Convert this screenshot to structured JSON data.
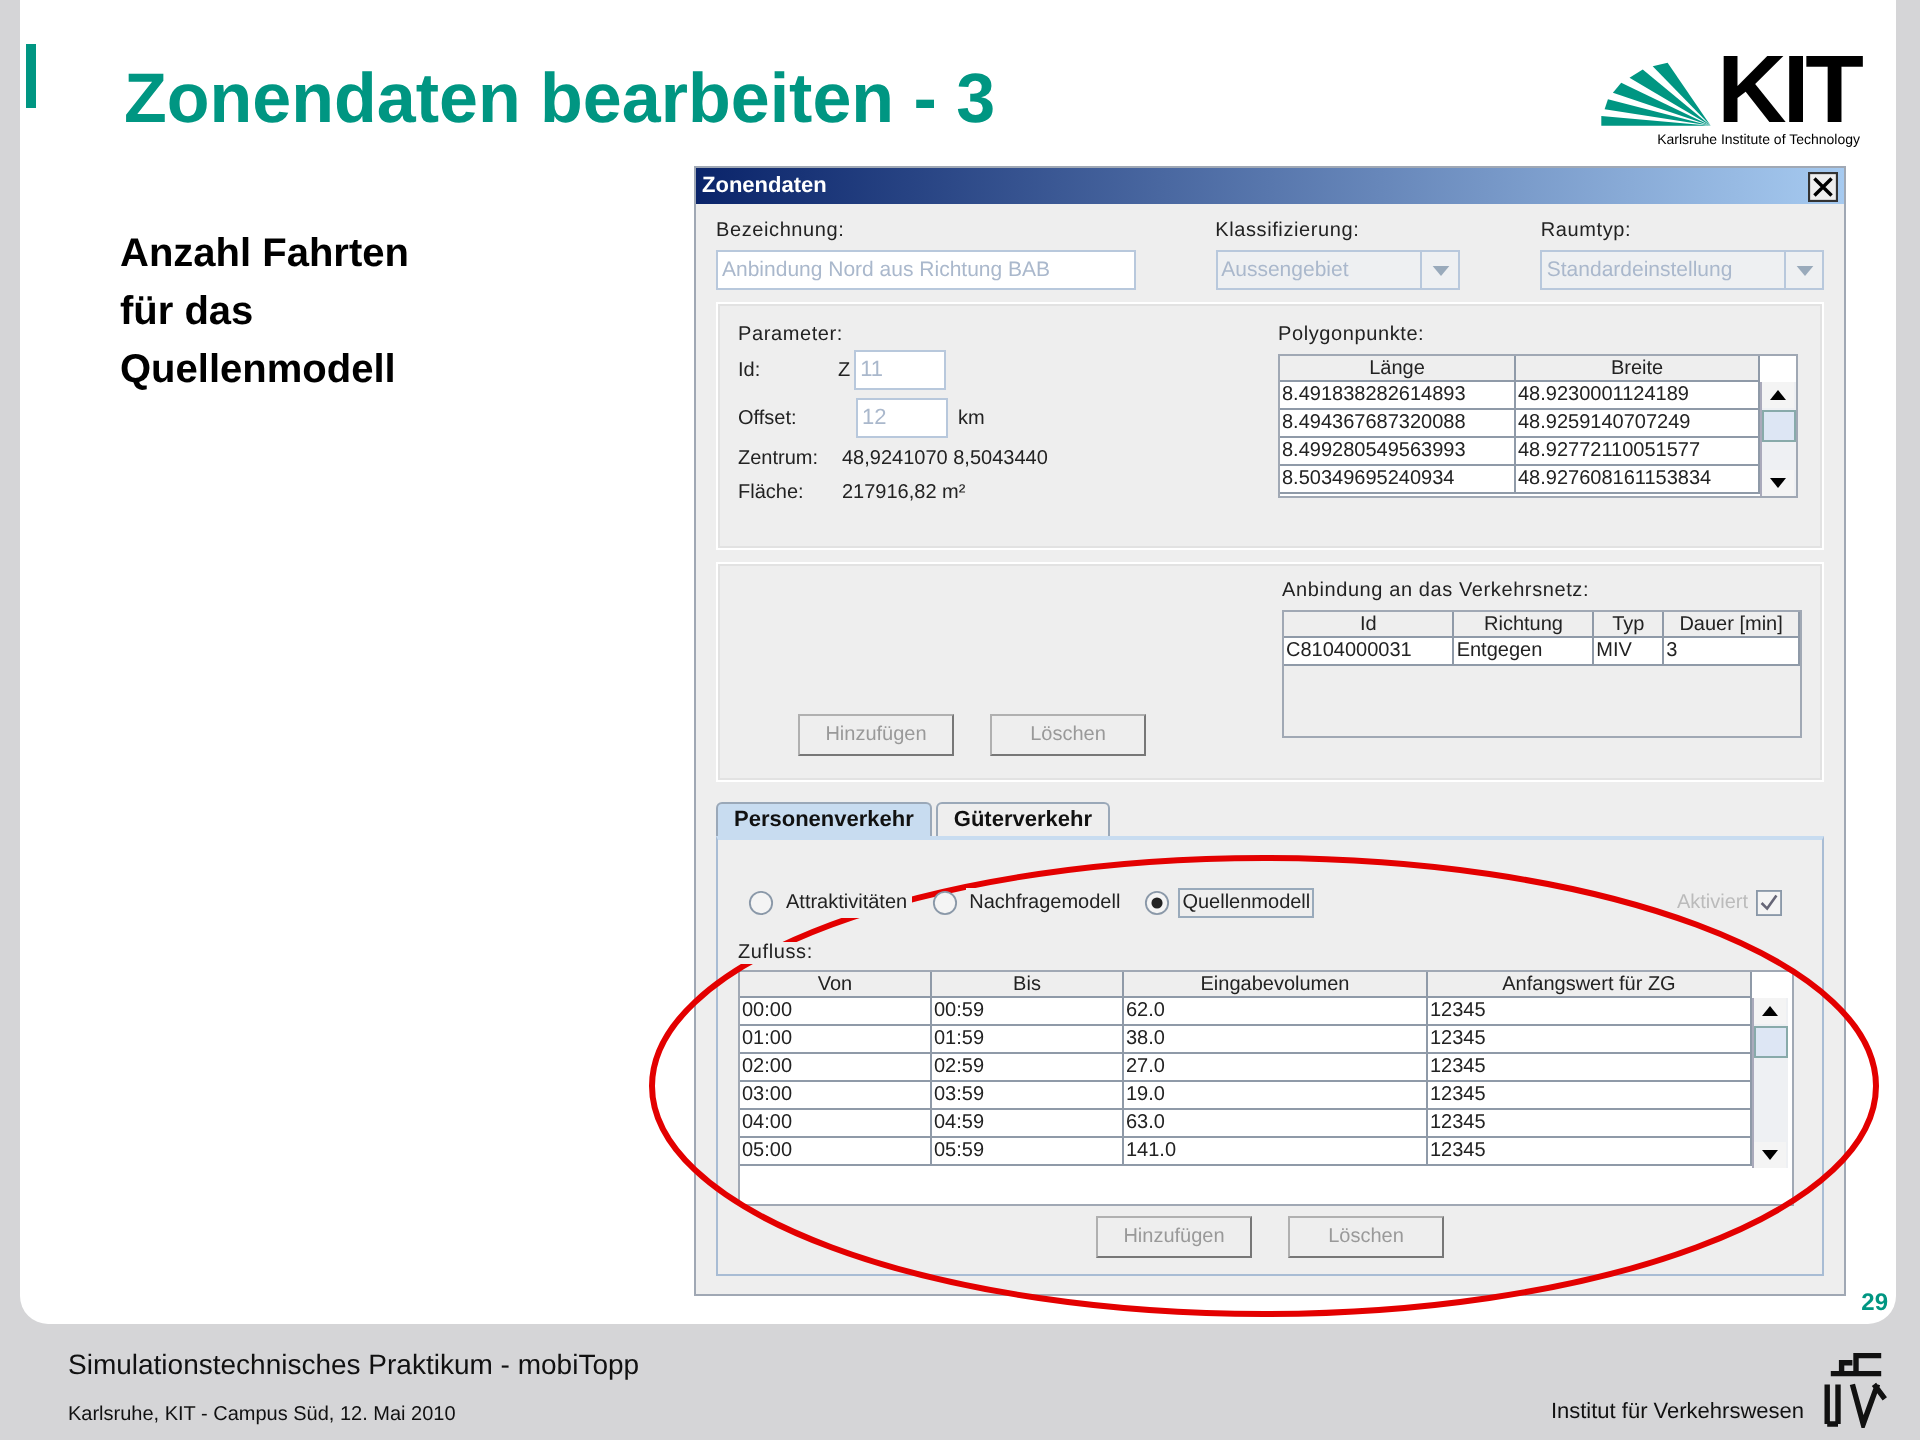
{
  "slide": {
    "title": "Zonendaten bearbeiten - 3",
    "subtitle": "Anzahl Fahrten\nfür das\nQuellenmodell",
    "page_number": "29"
  },
  "logo": {
    "wordmark": "KIT",
    "tagline": "Karlsruhe Institute of Technology"
  },
  "dialog": {
    "title": "Zonendaten",
    "fields": [
      {
        "kind": "text",
        "label": "Bezeichnung:",
        "value": "Anbindung Nord aus Richtung BAB"
      },
      {
        "kind": "combo",
        "label": "Klassifizierung:",
        "value": "Aussengebiet"
      },
      {
        "kind": "combo",
        "label": "Raumtyp:",
        "value": "Standardeinstellung"
      }
    ],
    "parameter": {
      "title": "Parameter:",
      "id_label": "Id:",
      "id_prefix": "Z",
      "id_value": "11",
      "offset_label": "Offset:",
      "offset_value": "12",
      "offset_unit": "km",
      "center_label": "Zentrum:",
      "center_value": "48,9241070 8,5043440",
      "area_label": "Fläche:",
      "area_value": "217916,82 m²"
    },
    "polygon": {
      "title": "Polygonpunkte:",
      "columns": [
        "Länge",
        "Breite"
      ],
      "rows": [
        [
          "8.491838282614893",
          "48.9230001124189"
        ],
        [
          "8.494367687320088",
          "48.9259140707249"
        ],
        [
          "8.499280549563993",
          "48.92772110051577"
        ],
        [
          "8.50349695240934",
          "48.927608161153834"
        ]
      ]
    },
    "connection": {
      "title": "Anbindung an das Verkehrsnetz:",
      "columns": [
        "Id",
        "Richtung",
        "Typ",
        "Dauer [min]"
      ],
      "rows": [
        [
          "C8104000031",
          "Entgegen",
          "MIV",
          "3"
        ]
      ],
      "buttons": [
        {
          "label": "Hinzufügen",
          "disabled": true
        },
        {
          "label": "Löschen",
          "disabled": true
        }
      ]
    },
    "tabs": [
      {
        "label": "Personenverkehr",
        "selected": true
      },
      {
        "label": "Güterverkehr",
        "selected": false
      }
    ],
    "model_options": [
      {
        "label": "Attraktivitäten",
        "selected": false
      },
      {
        "label": "Nachfragemodell",
        "selected": false
      },
      {
        "label": "Quellenmodell",
        "selected": true
      }
    ],
    "activated": {
      "label": "Aktiviert",
      "checked": true,
      "disabled": true
    },
    "inflow": {
      "title": "Zufluss:",
      "columns": [
        "Von",
        "Bis",
        "Eingabevolumen",
        "Anfangswert für ZG"
      ],
      "rows": [
        [
          "00:00",
          "00:59",
          "62.0",
          "12345"
        ],
        [
          "01:00",
          "01:59",
          "38.0",
          "12345"
        ],
        [
          "02:00",
          "02:59",
          "27.0",
          "12345"
        ],
        [
          "03:00",
          "03:59",
          "19.0",
          "12345"
        ],
        [
          "04:00",
          "04:59",
          "63.0",
          "12345"
        ],
        [
          "05:00",
          "05:59",
          "141.0",
          "12345"
        ]
      ],
      "buttons": [
        {
          "label": "Hinzufügen",
          "disabled": true
        },
        {
          "label": "Löschen",
          "disabled": true
        }
      ]
    }
  },
  "footer": {
    "course": "Simulationstechnisches Praktikum - mobiTopp",
    "place_date": "Karlsruhe, KIT - Campus Süd, 12. Mai  2010",
    "institute": "Institut für Verkehrswesen"
  }
}
